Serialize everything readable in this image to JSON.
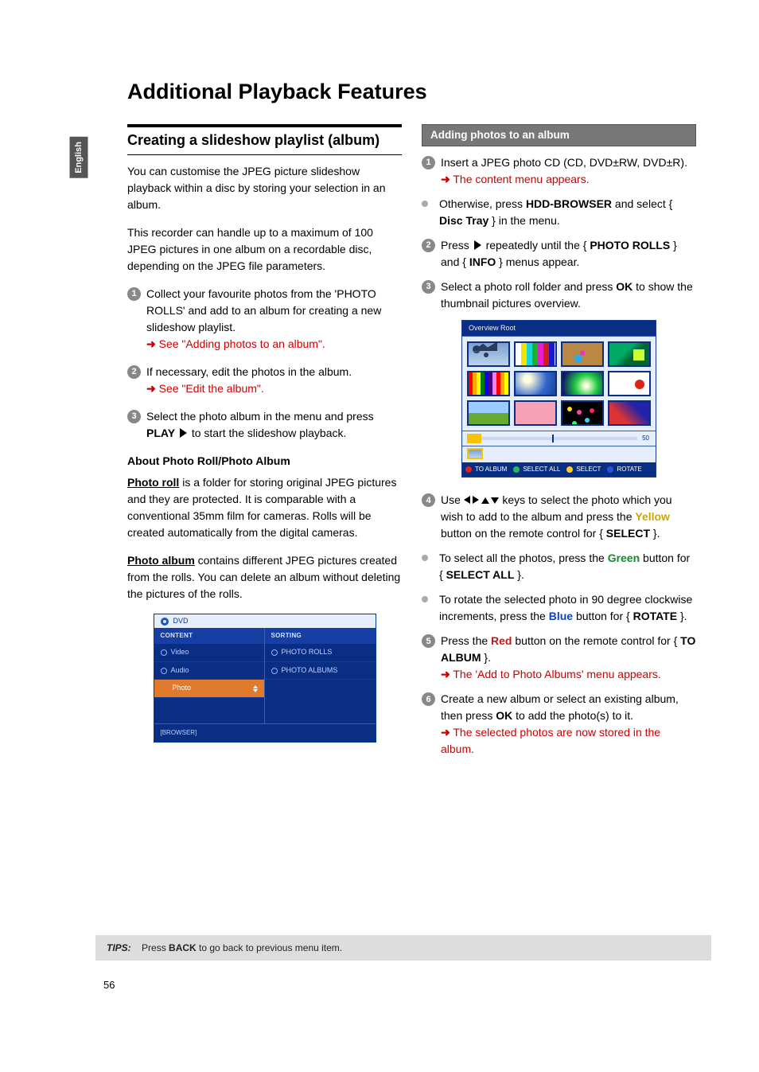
{
  "language_tab": "English",
  "page_title": "Additional Playback Features",
  "left": {
    "section_heading": "Creating a slideshow playlist (album)",
    "intro1": "You can customise the JPEG picture slideshow playback within a disc by storing your selection in an album.",
    "intro2": "This recorder can handle up to a maximum of 100 JPEG pictures in one album on a recordable disc, depending on the JPEG file parameters.",
    "step1_a": "Collect your favourite photos from the 'PHOTO ROLLS' and add to an album for creating a new slideshow playlist.",
    "step1_b": "See \"Adding photos to an album\".",
    "step2_a": "If necessary, edit the photos in the album.",
    "step2_b": "See \"Edit the album\".",
    "step3_a": "Select the photo album in the menu and press ",
    "step3_play": "PLAY",
    "step3_b": " to start the slideshow playback.",
    "about_heading": "About Photo Roll/Photo Album",
    "photoroll_label": "Photo roll",
    "photoroll_text": " is a folder for storing original JPEG pictures and they are protected. It is comparable with a conventional 35mm film for cameras. Rolls will be created automatically from the digital cameras.",
    "photoalbum_label": "Photo album",
    "photoalbum_text": " contains different JPEG pictures created from the rolls. You can delete an album without deleting the pictures of the rolls.",
    "menu": {
      "top": "DVD",
      "col1_head": "CONTENT",
      "rows1": [
        "Video",
        "Audio",
        "Photo"
      ],
      "col2_head": "SORTING",
      "rows2": [
        "PHOTO ROLLS",
        "PHOTO ALBUMS"
      ],
      "footer": "[BROWSER]"
    }
  },
  "right": {
    "banner": "Adding photos to an album",
    "s1_a": "Insert a JPEG photo CD (CD, DVD±RW, DVD±R).",
    "s1_b": "The content menu appears.",
    "bullet1_a": "Otherwise, press ",
    "hdd": "HDD-BROWSER",
    "bullet1_b": " and select { ",
    "disctray": "Disc Tray",
    "bullet1_c": " } in the menu.",
    "s2_a": "Press ",
    "s2_b": " repeatedly until the { ",
    "photorolls": "PHOTO ROLLS",
    "s2_c": " } and { ",
    "info": "INFO",
    "s2_d": " } menus appear.",
    "s3_a": "Select a photo roll folder and press ",
    "ok": "OK",
    "s3_b": " to show the thumbnail pictures overview.",
    "overview_title": "Overview Root",
    "overview_num": "50",
    "legend": {
      "toalbum": "TO ALBUM",
      "selectall": "SELECT ALL",
      "select": "SELECT",
      "rotate": "ROTATE"
    },
    "s4_a": "Use ",
    "s4_b": " keys to select the photo which you wish to add to the album and press the ",
    "yellow": "Yellow",
    "s4_c": " button on the remote control for { ",
    "select": "SELECT",
    "s4_d": " }.",
    "bullet2_a": "To select all the photos, press the ",
    "green": "Green",
    "bullet2_b": " button for { ",
    "selectall": "SELECT ALL",
    "bullet2_c": " }.",
    "bullet3_a": "To rotate the selected photo in 90 degree clockwise increments, press the ",
    "blue": "Blue",
    "bullet3_b": " button for { ",
    "rotate": "ROTATE",
    "bullet3_c": " }.",
    "s5_a": "Press the ",
    "red": "Red",
    "s5_b": " button on the remote control for { ",
    "toalbum": "TO ALBUM",
    "s5_c": " }.",
    "s5_d": "The 'Add to Photo Albums' menu appears.",
    "s6_a": "Create a new album or select an existing album, then press ",
    "s6_b": " to add the photo(s) to it.",
    "s6_c": "The selected photos are now stored in the album."
  },
  "tips": {
    "label": "TIPS:",
    "text_a": "Press ",
    "back": "BACK",
    "text_b": " to go back to previous menu item."
  },
  "page_number": "56"
}
